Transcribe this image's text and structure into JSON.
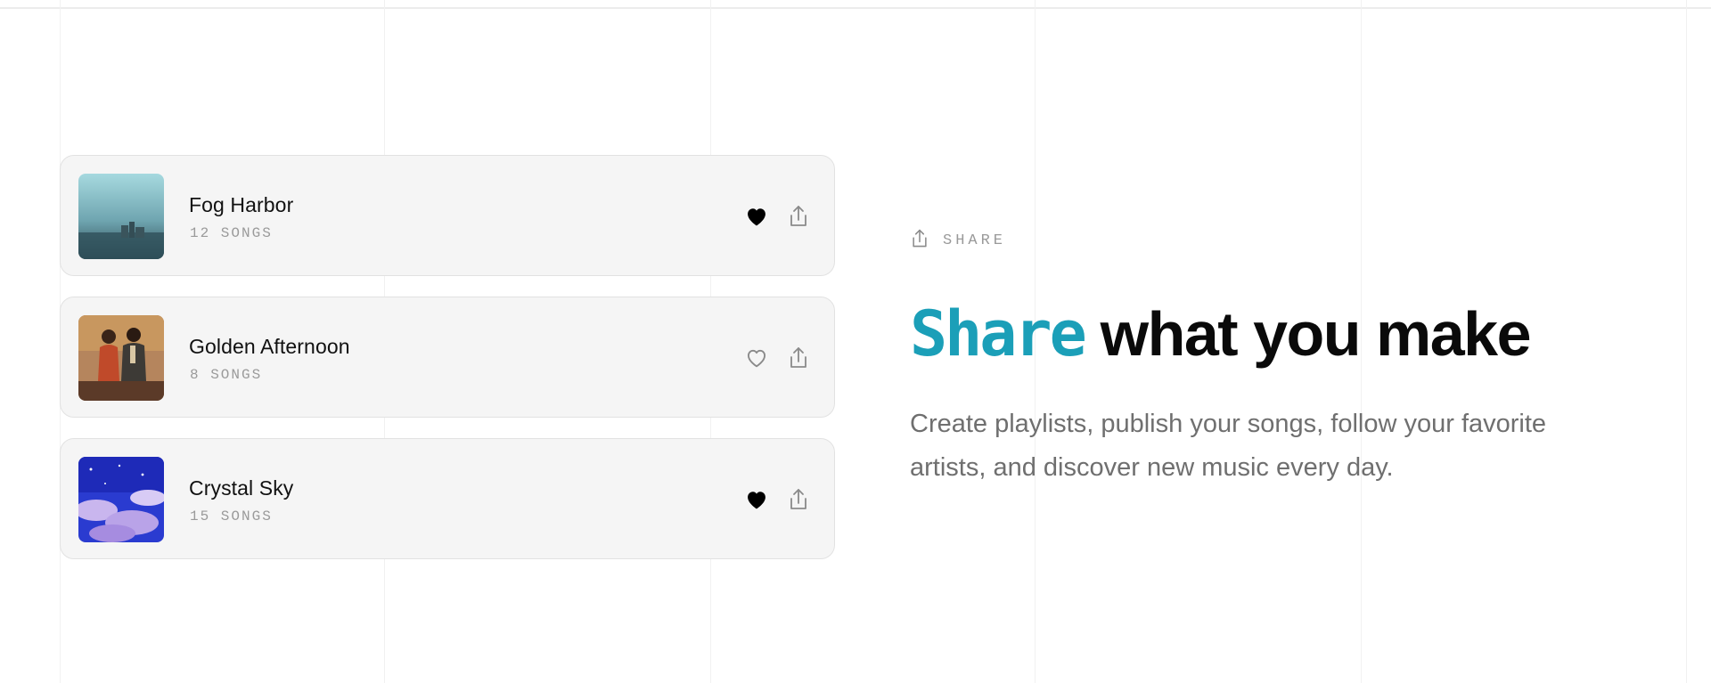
{
  "playlists": [
    {
      "title": "Fog Harbor",
      "count": "12 SONGS",
      "liked": true
    },
    {
      "title": "Golden Afternoon",
      "count": "8 SONGS",
      "liked": false
    },
    {
      "title": "Crystal Sky",
      "count": "15 SONGS",
      "liked": true
    }
  ],
  "icons": {
    "heart_filled": "heart-filled-icon",
    "heart_outline": "heart-outline-icon",
    "share": "share-icon"
  },
  "section": {
    "eyebrow": "SHARE",
    "headline_accent": "Share",
    "headline_rest": " what you make",
    "description": "Create playlists, publish your songs, follow your favorite artists, and discover new music every day."
  },
  "colors": {
    "accent": "#1b9fb8",
    "text": "#0a0a0a",
    "muted": "#6f6f6f",
    "card_bg": "#f5f5f5"
  }
}
